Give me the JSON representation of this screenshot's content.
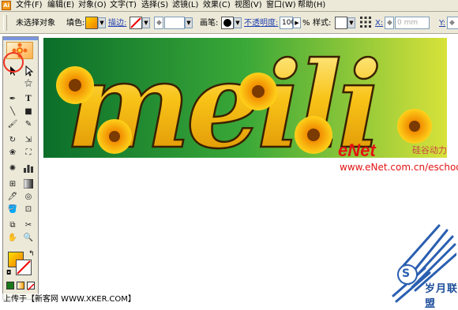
{
  "menubar": {
    "items": [
      "文件(F)",
      "编辑(E)",
      "对象(O)",
      "文字(T)",
      "选择(S)",
      "滤镜(L)",
      "效果(C)",
      "视图(V)",
      "窗口(W)",
      "帮助(H)"
    ]
  },
  "control_bar": {
    "selection_status": "未选择对象",
    "fill_label": "填色:",
    "stroke_label": "描边:",
    "brush_label": "画笔:",
    "opacity_label": "不透明度:",
    "opacity_value": "100",
    "percent_sign": "%",
    "style_label": "样式:",
    "x_label": "X:",
    "x_value": "0 mm",
    "y_label": "Y:"
  },
  "artwork": {
    "word": "meili",
    "logo": "eNet",
    "logo_subtitle": "硅谷动力",
    "url": "www.eNet.com.cn/eschool"
  },
  "watermark": {
    "text": "岁月联盟",
    "badge": "S"
  },
  "footer": {
    "text": "上传于【新客网 WWW.XKER.COM】"
  },
  "colors": {
    "chrome": "#ece9d8",
    "accent_blue": "#1f3fb0",
    "highlight_red": "#e32222",
    "art_green_dark": "#1e8a2c",
    "art_green_light": "#d7e23a",
    "letter_gold": "#f5c518"
  },
  "icons": [
    "selection-tool-icon",
    "direct-selection-tool-icon",
    "magic-wand-icon",
    "pen-tool-icon",
    "type-tool-icon",
    "line-tool-icon",
    "rectangle-tool-icon",
    "paintbrush-icon",
    "pencil-icon",
    "rotate-tool-icon",
    "scale-tool-icon",
    "warp-tool-icon",
    "free-transform-icon",
    "symbol-sprayer-icon",
    "graph-tool-icon",
    "mesh-tool-icon",
    "gradient-tool-icon",
    "eyedropper-icon",
    "blend-tool-icon",
    "live-paint-icon",
    "slice-tool-icon",
    "scissors-icon",
    "hand-tool-icon",
    "zoom-tool-icon"
  ]
}
